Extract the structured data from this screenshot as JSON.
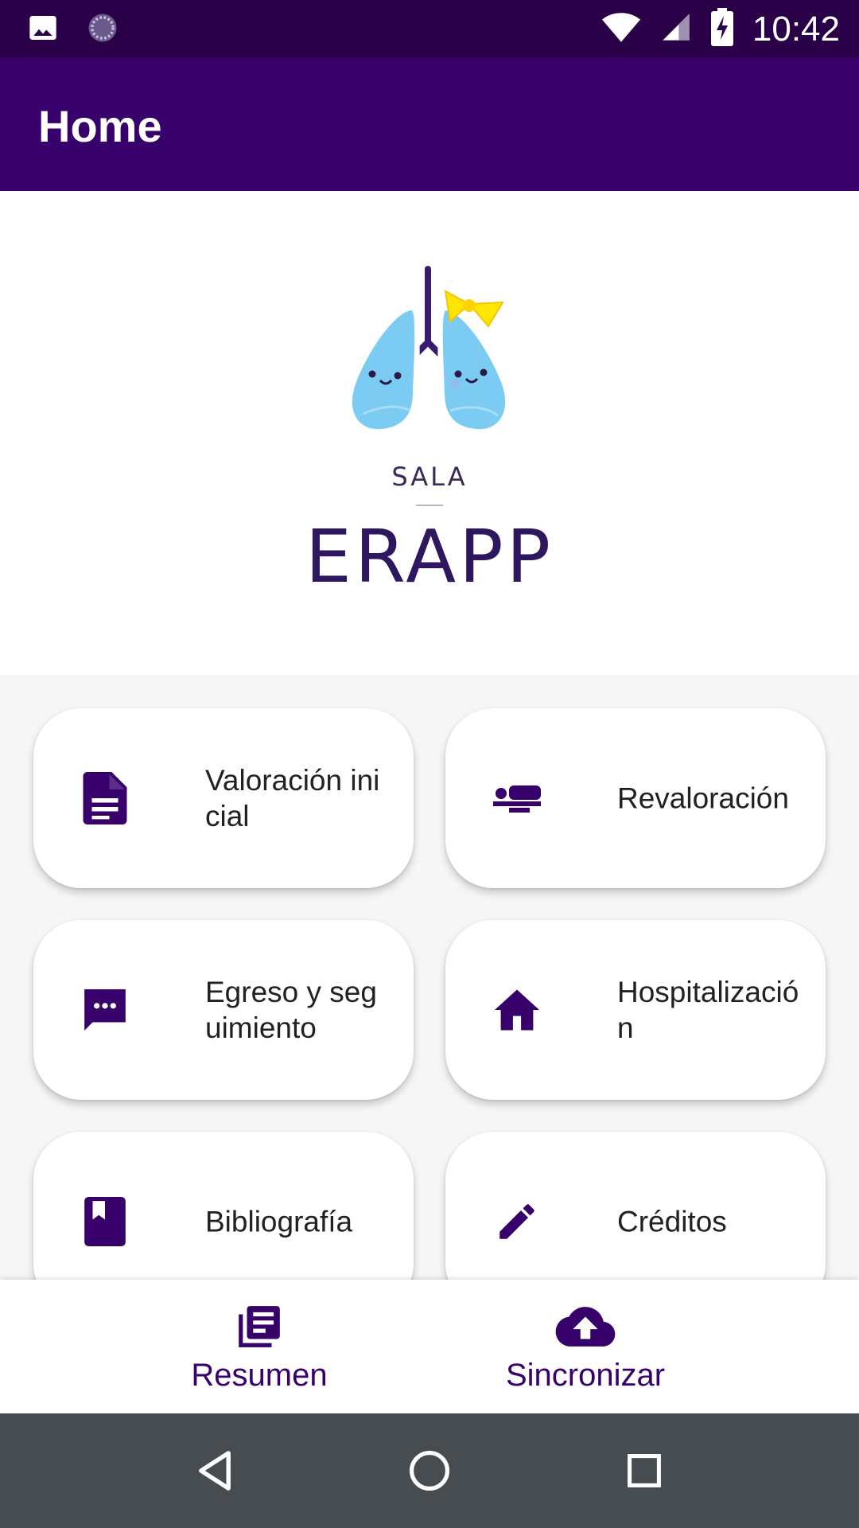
{
  "status_bar": {
    "time": "10:42",
    "left_icons": [
      "image-icon",
      "sync-spinner-icon"
    ],
    "right_icons": [
      "wifi-icon",
      "cell-signal-icon",
      "battery-charging-icon"
    ]
  },
  "app_bar": {
    "title": "Home"
  },
  "hero": {
    "logo_icon": "lungs-mascot-icon",
    "logo_top_text": "SALA",
    "logo_main_text": "ERAPP"
  },
  "menu": {
    "items": [
      {
        "label": "Valoración inicial",
        "icon": "document-icon"
      },
      {
        "label": "Revaloración",
        "icon": "bed-icon"
      },
      {
        "label": "Egreso y seguimiento",
        "icon": "message-icon"
      },
      {
        "label": "Hospitalización",
        "icon": "home-icon"
      },
      {
        "label": "Bibliografía",
        "icon": "book-icon"
      },
      {
        "label": "Créditos",
        "icon": "pencil-icon"
      }
    ]
  },
  "bottom_nav": {
    "items": [
      {
        "label": "Resumen",
        "icon": "library-books-icon"
      },
      {
        "label": "Sincronizar",
        "icon": "cloud-upload-icon"
      }
    ]
  },
  "system_nav": {
    "buttons": [
      "back-icon",
      "home-circle-icon",
      "recents-icon"
    ]
  },
  "colors": {
    "primary": "#37006a",
    "status_bar": "#2a0049",
    "card_bg": "#ffffff",
    "page_bg": "#f6f6f6",
    "system_nav_bg": "#474c50"
  }
}
